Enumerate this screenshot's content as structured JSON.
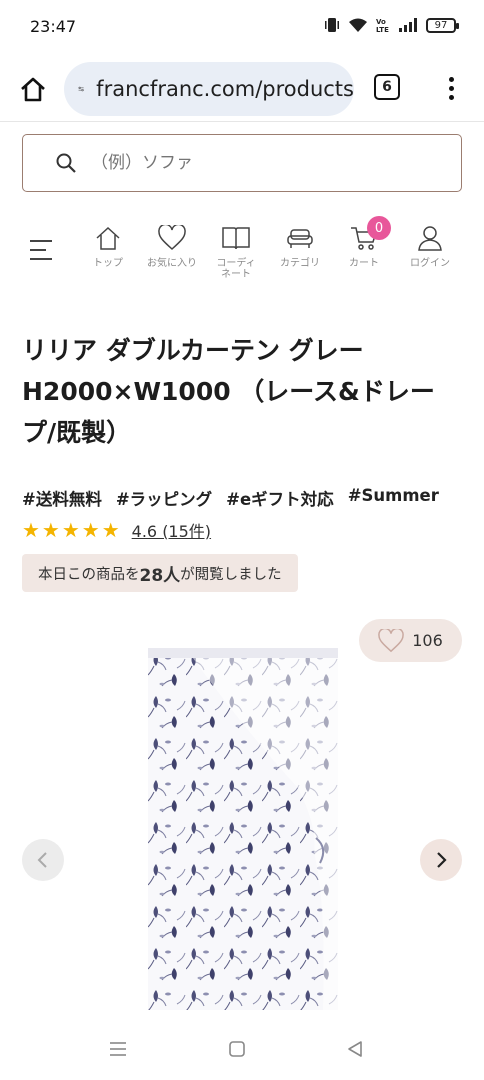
{
  "status_bar": {
    "time": "23:47",
    "battery": "97"
  },
  "browser": {
    "url": "francfranc.com/products",
    "tab_count": "6"
  },
  "search": {
    "placeholder": "（例）ソファ"
  },
  "nav": {
    "items": [
      {
        "label": "トップ",
        "icon": "home-icon"
      },
      {
        "label": "お気に入り",
        "icon": "heart-icon"
      },
      {
        "label": "コーディネート",
        "icon": "book-icon"
      },
      {
        "label": "カテゴリ",
        "icon": "sofa-icon"
      },
      {
        "label": "カート",
        "icon": "cart-icon"
      },
      {
        "label": "ログイン",
        "icon": "user-icon"
      }
    ],
    "cart_count": "0",
    "coordinate_line1": "コーディ",
    "coordinate_line2": "ネート"
  },
  "product": {
    "title": "リリア ダブルカーテン グレー H2000×W1000 （レース&ドレープ/既製）",
    "tags": [
      "#送料無料",
      "#ラッピング",
      "#eギフト対応",
      "#Summer"
    ],
    "stars": "★★★★★",
    "rating_text": "4.6 (15件)",
    "viewed_prefix": "本日この商品を",
    "viewed_count": "28人",
    "viewed_suffix": "が閲覧しました",
    "favorites": "106"
  },
  "colors": {
    "accent": "#e8579a",
    "search_border": "#9b7d70",
    "chip_bg": "#f1e7e3",
    "star": "#f4b400"
  }
}
